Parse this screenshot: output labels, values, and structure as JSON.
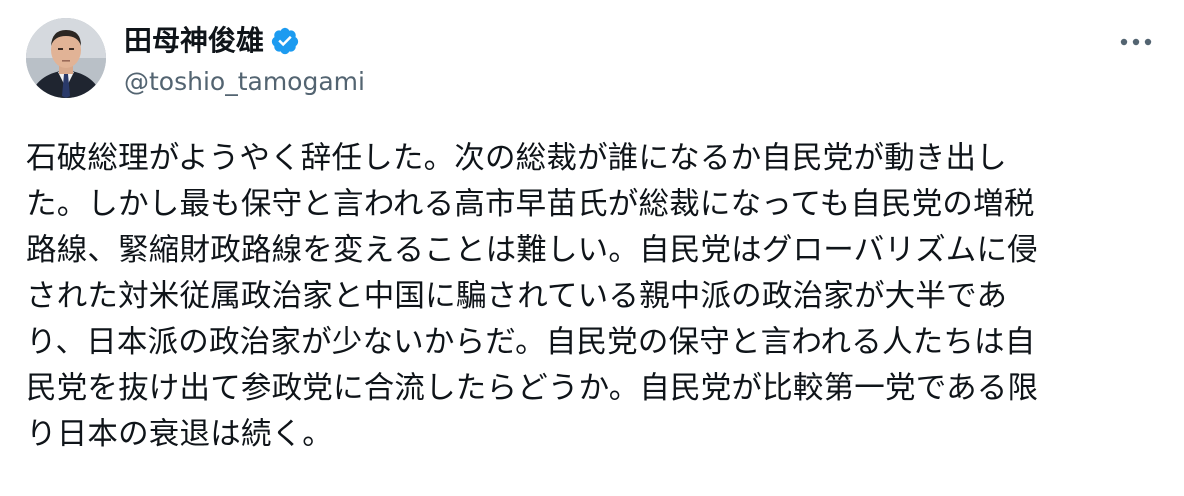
{
  "user": {
    "display_name": "田母神俊雄",
    "handle": "@toshio_tamogami",
    "verified": true,
    "verified_color": "#1d9bf0"
  },
  "icons": {
    "verified": "verified-badge-icon",
    "more": "more-horizontal-icon"
  },
  "tweet": {
    "lines": [
      "石破総理がようやく辞任した。次の総裁が誰になるか自民党が動き出し",
      "た。しかし最も保守と言われる高市早苗氏が総裁になっても自民党の増税",
      "路線、緊縮財政路線を変えることは難しい。自民党はグローバリズムに侵",
      "された対米従属政治家と中国に騙されている親中派の政治家が大半であ",
      "り、日本派の政治家が少ないからだ。自民党の保守と言われる人たちは自",
      "民党を抜け出て参政党に合流したらどうか。自民党が比較第一党である限",
      "り日本の衰退は続く。"
    ]
  }
}
